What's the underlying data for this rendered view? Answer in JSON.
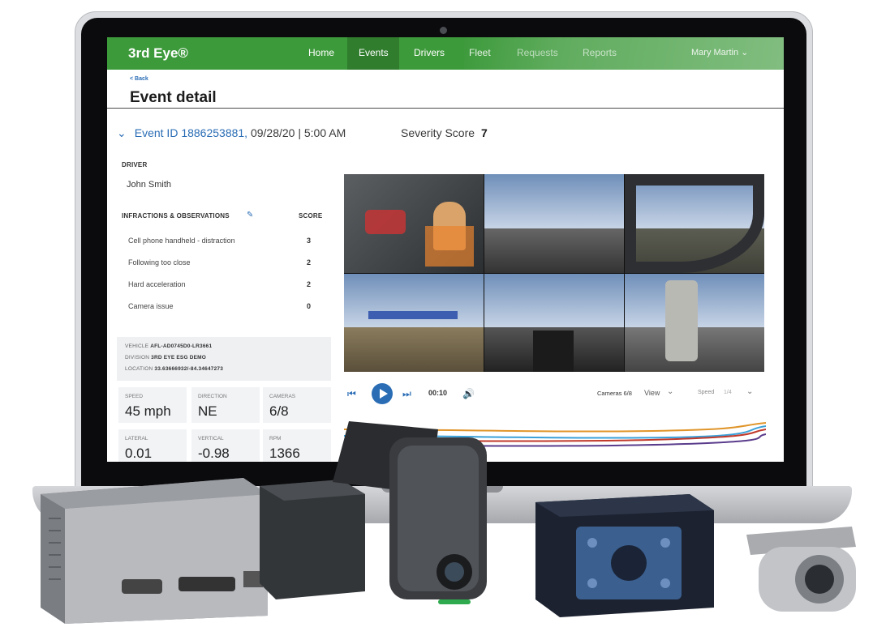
{
  "app": {
    "logo": "3rd Eye®",
    "nav": [
      "Home",
      "Events",
      "Drivers",
      "Fleet",
      "Requests",
      "Reports"
    ],
    "active_nav": "Events",
    "user": "Mary Martin ⌄"
  },
  "page": {
    "back": "< Back",
    "title": "Event detail",
    "event_id_label": "Event ID 1886253881,",
    "event_when": "09/28/20 | 5:00 AM",
    "severity_label": "Severity Score",
    "severity_value": "7"
  },
  "driver": {
    "label": "DRIVER",
    "name": "John Smith"
  },
  "infractions": {
    "label": "INFRACTIONS & OBSERVATIONS",
    "score_label": "SCORE",
    "rows": [
      {
        "name": "Cell phone handheld - distraction",
        "score": "3"
      },
      {
        "name": "Following too close",
        "score": "2"
      },
      {
        "name": "Hard acceleration",
        "score": "2"
      },
      {
        "name": "Camera issue",
        "score": "0"
      }
    ]
  },
  "vehicle": {
    "vehicle_label": "VEHICLE",
    "vehicle_value": "AFL-AD0745D0-LR3661",
    "division_label": "DIVISION",
    "division_value": "3RD EYE ESG DEMO",
    "location_label": "LOCATION",
    "location_value": "33.63666932/-84.34647273"
  },
  "stats": [
    {
      "label": "SPEED",
      "value": "45 mph"
    },
    {
      "label": "DIRECTION",
      "value": "NE"
    },
    {
      "label": "CAMERAS",
      "value": "6/8"
    },
    {
      "label": "LATERAL",
      "value": "0.01"
    },
    {
      "label": "VERTICAL",
      "value": "-0.98"
    },
    {
      "label": "RPM",
      "value": "1366"
    }
  ],
  "player": {
    "time": "00:10",
    "cameras": "Cameras 6/8",
    "view": "View",
    "speed_label": "Speed",
    "speed_value": "1/4"
  },
  "colors": {
    "nav_green": "#3d9a3b",
    "accent_blue": "#2a6db5",
    "graph_lines": [
      "#e0952a",
      "#3aa0d8",
      "#c0392b",
      "#5a3c8c"
    ]
  }
}
